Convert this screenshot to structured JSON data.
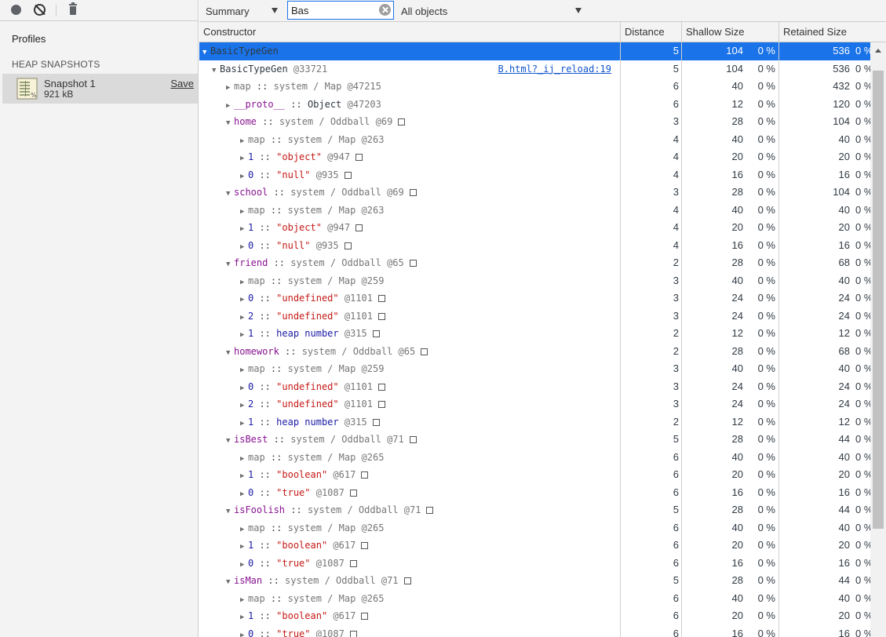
{
  "sidebar": {
    "toolbar": {
      "record_icon": "record-icon",
      "clear_icon": "clear-icon",
      "trash_icon": "trash-icon"
    },
    "profiles_title": "Profiles",
    "heap_heading": "HEAP SNAPSHOTS",
    "snapshot": {
      "name": "Snapshot 1",
      "size": "921 kB",
      "save_label": "Save"
    }
  },
  "toolbar": {
    "view": "Summary",
    "filter_value": "Bas",
    "objects": "All objects"
  },
  "columns": [
    "Constructor",
    "Distance",
    "Shallow Size",
    "Retained Size"
  ],
  "colors": {
    "selection": "#1a73e8",
    "property": "#881391",
    "string": "#c41a16",
    "number": "#1a1aa6",
    "link": "#1155cc"
  },
  "rows": [
    {
      "lvl": 0,
      "tri": "▼",
      "selected": true,
      "parts": [
        [
          "obj",
          "BasicTypeGen"
        ]
      ],
      "box": false,
      "dist": "5",
      "sh": "104",
      "shp": "0 %",
      "ret": "536",
      "retp": "0 %"
    },
    {
      "lvl": 1,
      "tri": "▼",
      "parts": [
        [
          "obj",
          "BasicTypeGen"
        ],
        [
          "id",
          " @33721"
        ]
      ],
      "box": false,
      "link": "B.html?_ij_reload:19",
      "dist": "5",
      "sh": "104",
      "shp": "0 %",
      "ret": "536",
      "retp": "0 %"
    },
    {
      "lvl": 2,
      "tri": "▶",
      "parts": [
        [
          "type",
          "map"
        ],
        [
          "sep",
          " :: "
        ],
        [
          "type",
          "system / Map"
        ],
        [
          "id",
          " @47215"
        ]
      ],
      "box": false,
      "dist": "6",
      "sh": "40",
      "shp": "0 %",
      "ret": "432",
      "retp": "0 %"
    },
    {
      "lvl": 2,
      "tri": "▶",
      "parts": [
        [
          "prop",
          "__proto__"
        ],
        [
          "sep",
          " :: "
        ],
        [
          "obj",
          "Object"
        ],
        [
          "id",
          " @47203"
        ]
      ],
      "box": false,
      "dist": "6",
      "sh": "12",
      "shp": "0 %",
      "ret": "120",
      "retp": "0 %"
    },
    {
      "lvl": 2,
      "tri": "▼",
      "parts": [
        [
          "prop",
          "home"
        ],
        [
          "sep",
          " :: "
        ],
        [
          "type",
          "system / Oddball"
        ],
        [
          "id",
          " @69"
        ]
      ],
      "box": true,
      "dist": "3",
      "sh": "28",
      "shp": "0 %",
      "ret": "104",
      "retp": "0 %"
    },
    {
      "lvl": 3,
      "tri": "▶",
      "parts": [
        [
          "type",
          "map"
        ],
        [
          "sep",
          " :: "
        ],
        [
          "type",
          "system / Map"
        ],
        [
          "id",
          " @263"
        ]
      ],
      "box": false,
      "dist": "4",
      "sh": "40",
      "shp": "0 %",
      "ret": "40",
      "retp": "0 %"
    },
    {
      "lvl": 3,
      "tri": "▶",
      "parts": [
        [
          "num",
          "1"
        ],
        [
          "sep",
          " :: "
        ],
        [
          "str",
          "\"object\""
        ],
        [
          "id",
          " @947"
        ]
      ],
      "box": true,
      "dist": "4",
      "sh": "20",
      "shp": "0 %",
      "ret": "20",
      "retp": "0 %"
    },
    {
      "lvl": 3,
      "tri": "▶",
      "parts": [
        [
          "num",
          "0"
        ],
        [
          "sep",
          " :: "
        ],
        [
          "str",
          "\"null\""
        ],
        [
          "id",
          " @935"
        ]
      ],
      "box": true,
      "dist": "4",
      "sh": "16",
      "shp": "0 %",
      "ret": "16",
      "retp": "0 %"
    },
    {
      "lvl": 2,
      "tri": "▼",
      "parts": [
        [
          "prop",
          "school"
        ],
        [
          "sep",
          " :: "
        ],
        [
          "type",
          "system / Oddball"
        ],
        [
          "id",
          " @69"
        ]
      ],
      "box": true,
      "dist": "3",
      "sh": "28",
      "shp": "0 %",
      "ret": "104",
      "retp": "0 %"
    },
    {
      "lvl": 3,
      "tri": "▶",
      "parts": [
        [
          "type",
          "map"
        ],
        [
          "sep",
          " :: "
        ],
        [
          "type",
          "system / Map"
        ],
        [
          "id",
          " @263"
        ]
      ],
      "box": false,
      "dist": "4",
      "sh": "40",
      "shp": "0 %",
      "ret": "40",
      "retp": "0 %"
    },
    {
      "lvl": 3,
      "tri": "▶",
      "parts": [
        [
          "num",
          "1"
        ],
        [
          "sep",
          " :: "
        ],
        [
          "str",
          "\"object\""
        ],
        [
          "id",
          " @947"
        ]
      ],
      "box": true,
      "dist": "4",
      "sh": "20",
      "shp": "0 %",
      "ret": "20",
      "retp": "0 %"
    },
    {
      "lvl": 3,
      "tri": "▶",
      "parts": [
        [
          "num",
          "0"
        ],
        [
          "sep",
          " :: "
        ],
        [
          "str",
          "\"null\""
        ],
        [
          "id",
          " @935"
        ]
      ],
      "box": true,
      "dist": "4",
      "sh": "16",
      "shp": "0 %",
      "ret": "16",
      "retp": "0 %"
    },
    {
      "lvl": 2,
      "tri": "▼",
      "parts": [
        [
          "prop",
          "friend"
        ],
        [
          "sep",
          " :: "
        ],
        [
          "type",
          "system / Oddball"
        ],
        [
          "id",
          " @65"
        ]
      ],
      "box": true,
      "dist": "2",
      "sh": "28",
      "shp": "0 %",
      "ret": "68",
      "retp": "0 %"
    },
    {
      "lvl": 3,
      "tri": "▶",
      "parts": [
        [
          "type",
          "map"
        ],
        [
          "sep",
          " :: "
        ],
        [
          "type",
          "system / Map"
        ],
        [
          "id",
          " @259"
        ]
      ],
      "box": false,
      "dist": "3",
      "sh": "40",
      "shp": "0 %",
      "ret": "40",
      "retp": "0 %"
    },
    {
      "lvl": 3,
      "tri": "▶",
      "parts": [
        [
          "num",
          "0"
        ],
        [
          "sep",
          " :: "
        ],
        [
          "str",
          "\"undefined\""
        ],
        [
          "id",
          " @1101"
        ]
      ],
      "box": true,
      "dist": "3",
      "sh": "24",
      "shp": "0 %",
      "ret": "24",
      "retp": "0 %"
    },
    {
      "lvl": 3,
      "tri": "▶",
      "parts": [
        [
          "num",
          "2"
        ],
        [
          "sep",
          " :: "
        ],
        [
          "str",
          "\"undefined\""
        ],
        [
          "id",
          " @1101"
        ]
      ],
      "box": true,
      "dist": "3",
      "sh": "24",
      "shp": "0 %",
      "ret": "24",
      "retp": "0 %"
    },
    {
      "lvl": 3,
      "tri": "▶",
      "parts": [
        [
          "num",
          "1"
        ],
        [
          "sep",
          " :: "
        ],
        [
          "num",
          "heap number"
        ],
        [
          "id",
          " @315"
        ]
      ],
      "box": true,
      "dist": "2",
      "sh": "12",
      "shp": "0 %",
      "ret": "12",
      "retp": "0 %"
    },
    {
      "lvl": 2,
      "tri": "▼",
      "parts": [
        [
          "prop",
          "homework"
        ],
        [
          "sep",
          " :: "
        ],
        [
          "type",
          "system / Oddball"
        ],
        [
          "id",
          " @65"
        ]
      ],
      "box": true,
      "dist": "2",
      "sh": "28",
      "shp": "0 %",
      "ret": "68",
      "retp": "0 %"
    },
    {
      "lvl": 3,
      "tri": "▶",
      "parts": [
        [
          "type",
          "map"
        ],
        [
          "sep",
          " :: "
        ],
        [
          "type",
          "system / Map"
        ],
        [
          "id",
          " @259"
        ]
      ],
      "box": false,
      "dist": "3",
      "sh": "40",
      "shp": "0 %",
      "ret": "40",
      "retp": "0 %"
    },
    {
      "lvl": 3,
      "tri": "▶",
      "parts": [
        [
          "num",
          "0"
        ],
        [
          "sep",
          " :: "
        ],
        [
          "str",
          "\"undefined\""
        ],
        [
          "id",
          " @1101"
        ]
      ],
      "box": true,
      "dist": "3",
      "sh": "24",
      "shp": "0 %",
      "ret": "24",
      "retp": "0 %"
    },
    {
      "lvl": 3,
      "tri": "▶",
      "parts": [
        [
          "num",
          "2"
        ],
        [
          "sep",
          " :: "
        ],
        [
          "str",
          "\"undefined\""
        ],
        [
          "id",
          " @1101"
        ]
      ],
      "box": true,
      "dist": "3",
      "sh": "24",
      "shp": "0 %",
      "ret": "24",
      "retp": "0 %"
    },
    {
      "lvl": 3,
      "tri": "▶",
      "parts": [
        [
          "num",
          "1"
        ],
        [
          "sep",
          " :: "
        ],
        [
          "num",
          "heap number"
        ],
        [
          "id",
          " @315"
        ]
      ],
      "box": true,
      "dist": "2",
      "sh": "12",
      "shp": "0 %",
      "ret": "12",
      "retp": "0 %"
    },
    {
      "lvl": 2,
      "tri": "▼",
      "parts": [
        [
          "prop",
          "isBest"
        ],
        [
          "sep",
          " :: "
        ],
        [
          "type",
          "system / Oddball"
        ],
        [
          "id",
          " @71"
        ]
      ],
      "box": true,
      "dist": "5",
      "sh": "28",
      "shp": "0 %",
      "ret": "44",
      "retp": "0 %"
    },
    {
      "lvl": 3,
      "tri": "▶",
      "parts": [
        [
          "type",
          "map"
        ],
        [
          "sep",
          " :: "
        ],
        [
          "type",
          "system / Map"
        ],
        [
          "id",
          " @265"
        ]
      ],
      "box": false,
      "dist": "6",
      "sh": "40",
      "shp": "0 %",
      "ret": "40",
      "retp": "0 %"
    },
    {
      "lvl": 3,
      "tri": "▶",
      "parts": [
        [
          "num",
          "1"
        ],
        [
          "sep",
          " :: "
        ],
        [
          "str",
          "\"boolean\""
        ],
        [
          "id",
          " @617"
        ]
      ],
      "box": true,
      "dist": "6",
      "sh": "20",
      "shp": "0 %",
      "ret": "20",
      "retp": "0 %"
    },
    {
      "lvl": 3,
      "tri": "▶",
      "parts": [
        [
          "num",
          "0"
        ],
        [
          "sep",
          " :: "
        ],
        [
          "str",
          "\"true\""
        ],
        [
          "id",
          " @1087"
        ]
      ],
      "box": true,
      "dist": "6",
      "sh": "16",
      "shp": "0 %",
      "ret": "16",
      "retp": "0 %"
    },
    {
      "lvl": 2,
      "tri": "▼",
      "parts": [
        [
          "prop",
          "isFoolish"
        ],
        [
          "sep",
          " :: "
        ],
        [
          "type",
          "system / Oddball"
        ],
        [
          "id",
          " @71"
        ]
      ],
      "box": true,
      "dist": "5",
      "sh": "28",
      "shp": "0 %",
      "ret": "44",
      "retp": "0 %"
    },
    {
      "lvl": 3,
      "tri": "▶",
      "parts": [
        [
          "type",
          "map"
        ],
        [
          "sep",
          " :: "
        ],
        [
          "type",
          "system / Map"
        ],
        [
          "id",
          " @265"
        ]
      ],
      "box": false,
      "dist": "6",
      "sh": "40",
      "shp": "0 %",
      "ret": "40",
      "retp": "0 %"
    },
    {
      "lvl": 3,
      "tri": "▶",
      "parts": [
        [
          "num",
          "1"
        ],
        [
          "sep",
          " :: "
        ],
        [
          "str",
          "\"boolean\""
        ],
        [
          "id",
          " @617"
        ]
      ],
      "box": true,
      "dist": "6",
      "sh": "20",
      "shp": "0 %",
      "ret": "20",
      "retp": "0 %"
    },
    {
      "lvl": 3,
      "tri": "▶",
      "parts": [
        [
          "num",
          "0"
        ],
        [
          "sep",
          " :: "
        ],
        [
          "str",
          "\"true\""
        ],
        [
          "id",
          " @1087"
        ]
      ],
      "box": true,
      "dist": "6",
      "sh": "16",
      "shp": "0 %",
      "ret": "16",
      "retp": "0 %"
    },
    {
      "lvl": 2,
      "tri": "▼",
      "parts": [
        [
          "prop",
          "isMan"
        ],
        [
          "sep",
          " :: "
        ],
        [
          "type",
          "system / Oddball"
        ],
        [
          "id",
          " @71"
        ]
      ],
      "box": true,
      "dist": "5",
      "sh": "28",
      "shp": "0 %",
      "ret": "44",
      "retp": "0 %"
    },
    {
      "lvl": 3,
      "tri": "▶",
      "parts": [
        [
          "type",
          "map"
        ],
        [
          "sep",
          " :: "
        ],
        [
          "type",
          "system / Map"
        ],
        [
          "id",
          " @265"
        ]
      ],
      "box": false,
      "dist": "6",
      "sh": "40",
      "shp": "0 %",
      "ret": "40",
      "retp": "0 %"
    },
    {
      "lvl": 3,
      "tri": "▶",
      "parts": [
        [
          "num",
          "1"
        ],
        [
          "sep",
          " :: "
        ],
        [
          "str",
          "\"boolean\""
        ],
        [
          "id",
          " @617"
        ]
      ],
      "box": true,
      "dist": "6",
      "sh": "20",
      "shp": "0 %",
      "ret": "20",
      "retp": "0 %"
    },
    {
      "lvl": 3,
      "tri": "▶",
      "parts": [
        [
          "num",
          "0"
        ],
        [
          "sep",
          " :: "
        ],
        [
          "str",
          "\"true\""
        ],
        [
          "id",
          " @1087"
        ]
      ],
      "box": true,
      "dist": "6",
      "sh": "16",
      "shp": "0 %",
      "ret": "16",
      "retp": "0 %"
    }
  ]
}
